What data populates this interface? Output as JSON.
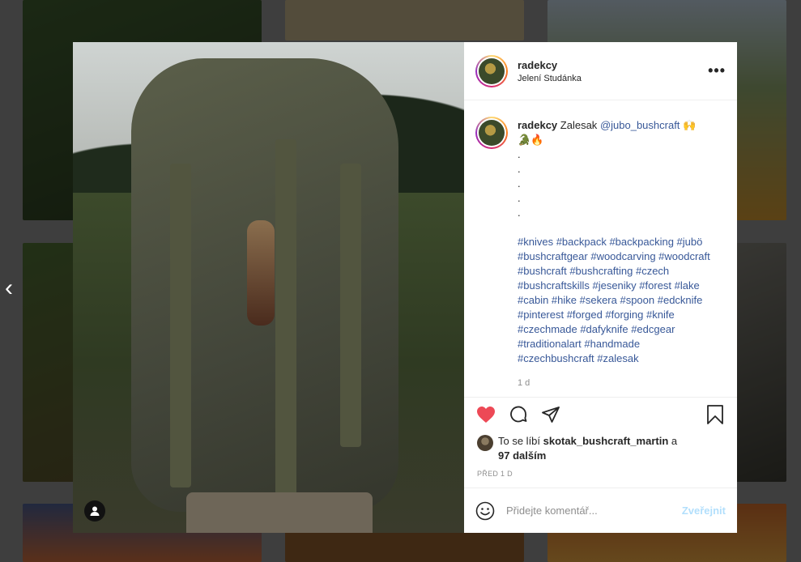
{
  "post": {
    "username": "radekcy",
    "location": "Jelení Studánka",
    "more_glyph": "•••"
  },
  "caption": {
    "username": "radekcy",
    "text_start": "Zalesak",
    "mention": "@jubo_bushcraft",
    "emoji_line1": "🙌",
    "emoji_line2": "🐊🔥",
    "dots": [
      ".",
      ".",
      ".",
      ".",
      "."
    ],
    "hashtags": "#knives #backpack #backpacking #jubö #bushcraftgear #woodcarving #woodcraft #bushcraft #bushcrafting #czech #bushcraftskills #jeseniky #forest #lake #cabin #hike #sekera #spoon #edcknife #pinterest #forged #forging #knife #czechmade #dafyknife #edcgear #traditionalart #handmade #czechbushcraft #zalesak",
    "time_ago": "1 d"
  },
  "likes": {
    "prefix": "To se líbí",
    "liker": "skotak_bushcraft_martin",
    "and": "a",
    "others": "97 dalším"
  },
  "date_label": "PŘED 1 D",
  "comment": {
    "placeholder": "Přidejte komentář...",
    "post_label": "Zveřejnit"
  },
  "nav": {
    "prev_glyph": "‹"
  },
  "icons": [
    "chevron-left-icon",
    "more-icon",
    "heart-icon",
    "comment-icon",
    "share-icon",
    "bookmark-icon",
    "emoji-icon",
    "user-tag-icon"
  ],
  "colors": {
    "like": "#ed4956",
    "link": "#385898",
    "post_button_disabled": "#b2dffc"
  }
}
